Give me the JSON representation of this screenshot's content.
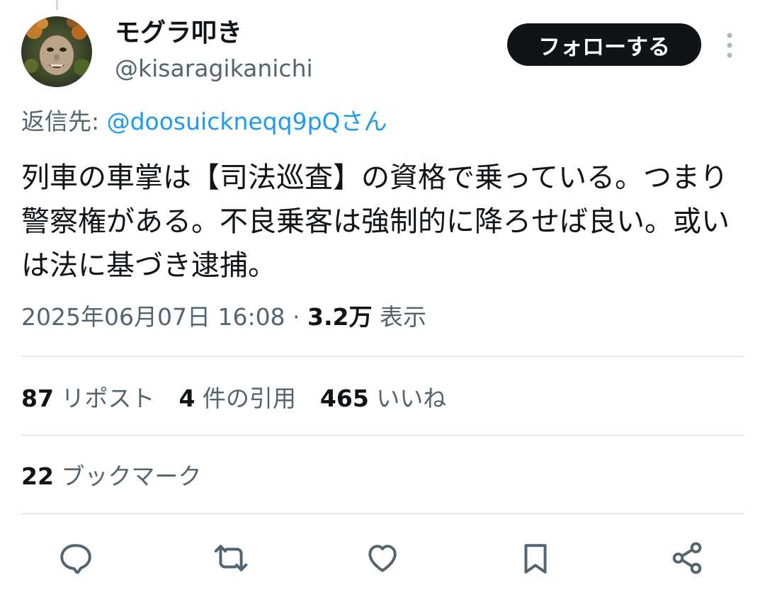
{
  "author": {
    "display_name": "モグラ叩き",
    "handle": "@kisaragikanichi"
  },
  "follow_label": "フォローする",
  "reply_to": {
    "prefix": "返信先: ",
    "mention": "@doosuickneqq9pQさん"
  },
  "tweet_text": "列車の車掌は【司法巡査】の資格で乗っている。つまり警察権がある。不良乗客は強制的に降ろせば良い。或いは法に基づき逮捕。",
  "meta": {
    "timestamp": "2025年06月07日 16:08",
    "separator": " · ",
    "views_count": "3.2万",
    "views_label": " 表示"
  },
  "stats": {
    "reposts_count": "87",
    "reposts_label": " リポスト",
    "quotes_count": "4",
    "quotes_label": " 件の引用",
    "likes_count": "465",
    "likes_label": " いいね",
    "bookmarks_count": "22",
    "bookmarks_label": " ブックマーク"
  },
  "icons": {
    "more": "more-vertical-icon",
    "reply": "reply-icon",
    "retweet": "retweet-icon",
    "like": "heart-icon",
    "bookmark": "bookmark-icon",
    "share": "share-icon"
  },
  "colors": {
    "accent": "#1d9bf0",
    "secondary_text": "#536471",
    "primary_text": "#0f1419",
    "divider": "#cfd9de"
  }
}
